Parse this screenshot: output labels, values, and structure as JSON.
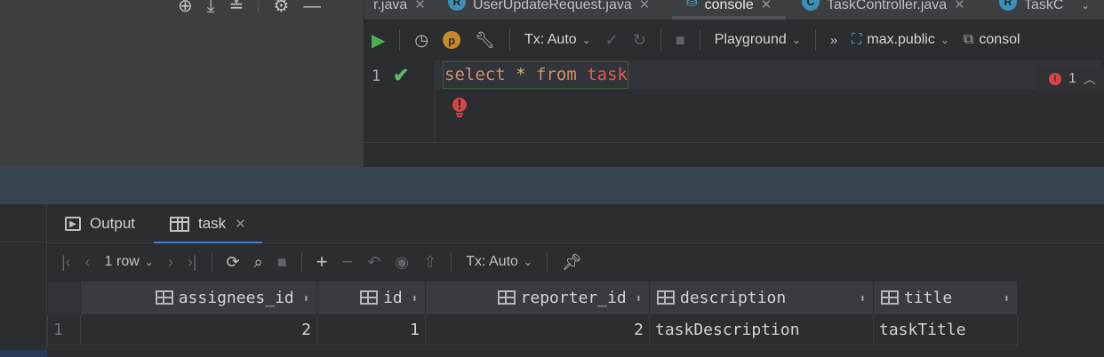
{
  "tabs": [
    {
      "label": "r.java",
      "badge": ""
    },
    {
      "label": "UserUpdateRequest.java",
      "badge": "R"
    },
    {
      "label": "console",
      "badge": ""
    },
    {
      "label": "TaskController.java",
      "badge": "C"
    },
    {
      "label": "TaskC",
      "badge": "R"
    }
  ],
  "console_toolbar": {
    "tx_mode": "Tx: Auto",
    "playground": "Playground",
    "schema": "max.public",
    "console_label": "consol",
    "p_badge": "p",
    "more": "»"
  },
  "editor": {
    "line_number": "1",
    "code": {
      "kw1": "select",
      "op": "*",
      "kw2": "from",
      "table": "task"
    },
    "problems_count": "1"
  },
  "results": {
    "tabs": [
      {
        "label": "Output"
      },
      {
        "label": "task"
      }
    ],
    "row_count_label": "1 row",
    "tx_mode": "Tx: Auto",
    "columns": [
      "assignees_id",
      "id",
      "reporter_id",
      "description",
      "title"
    ],
    "rows": [
      {
        "num": "1",
        "cells": [
          "2",
          "1",
          "2",
          "taskDescription",
          "taskTitle"
        ]
      }
    ]
  },
  "colors": {
    "accent": "#3f7ed6",
    "run_green": "#4caf50",
    "error_red": "#d64545"
  }
}
